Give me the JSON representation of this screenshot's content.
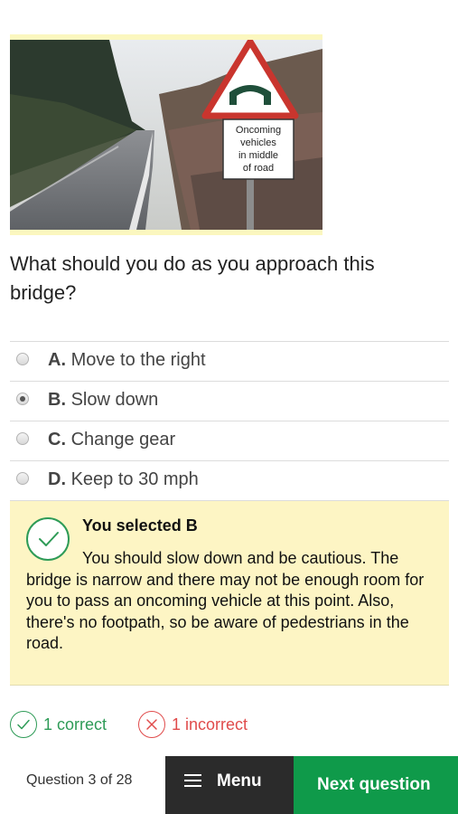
{
  "picture": {
    "sign_text": [
      "Oncoming",
      "vehicles",
      "in middle",
      "of road"
    ]
  },
  "question": {
    "text": "What should you do as you approach this bridge?"
  },
  "options": [
    {
      "letter": "A.",
      "text": "Move to the right",
      "selected": false
    },
    {
      "letter": "B.",
      "text": "Slow down",
      "selected": true
    },
    {
      "letter": "C.",
      "text": "Change gear",
      "selected": false
    },
    {
      "letter": "D.",
      "text": "Keep to 30 mph",
      "selected": false
    }
  ],
  "feedback": {
    "title": "You selected B",
    "explanation": "You should slow down and be cautious. The bridge is narrow and there may not be enough room for you to pass an oncoming vehicle at this point. Also, there's no footpath, so be aware of pedestrians in the road.",
    "icon": "check-icon"
  },
  "score": {
    "correct": "1 correct",
    "incorrect": "1 incorrect"
  },
  "footer": {
    "progress": "Question 3 of 28",
    "menu_label": "Menu",
    "next_label": "Next question"
  },
  "colors": {
    "correct": "#2e9b57",
    "incorrect": "#e04b4b",
    "feedback_bg": "#fdf5c4",
    "menu_bg": "#2b2b2b",
    "next_bg": "#0f9a4a"
  }
}
